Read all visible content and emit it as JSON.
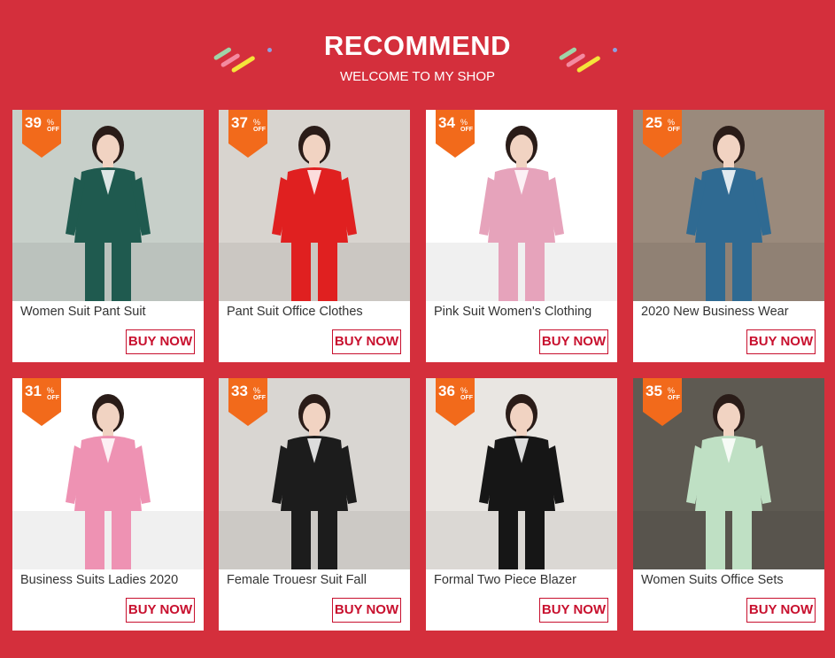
{
  "header": {
    "title": "RECOMMEND",
    "subtitle": "WELCOME TO MY SHOP"
  },
  "colors": {
    "background": "#d42f3c",
    "badge": "#f26a1b",
    "button": "#c8102e"
  },
  "products": [
    {
      "name": "Women Suit Pant Suit",
      "discount": "39",
      "pct": "%",
      "off": "OFF",
      "buy_label": "BUY NOW",
      "suit_color": "#1f5a4f",
      "bg": "#c7cfc9"
    },
    {
      "name": "Pant Suit Office Clothes",
      "discount": "37",
      "pct": "%",
      "off": "OFF",
      "buy_label": "BUY NOW",
      "suit_color": "#e02020",
      "bg": "#d8d4cf"
    },
    {
      "name": "Pink Suit Women's Clothing",
      "discount": "34",
      "pct": "%",
      "off": "OFF",
      "buy_label": "BUY NOW",
      "suit_color": "#e6a3bb",
      "bg": "#ffffff"
    },
    {
      "name": "2020 New Business Wear",
      "discount": "25",
      "pct": "%",
      "off": "OFF",
      "buy_label": "BUY NOW",
      "suit_color": "#2f6a92",
      "bg": "#9a8a7c"
    },
    {
      "name": "Business Suits Ladies 2020",
      "discount": "31",
      "pct": "%",
      "off": "OFF",
      "buy_label": "BUY NOW",
      "suit_color": "#ee92b3",
      "bg": "#ffffff"
    },
    {
      "name": "Female Trouesr Suit Fall",
      "discount": "33",
      "pct": "%",
      "off": "OFF",
      "buy_label": "BUY NOW",
      "suit_color": "#1c1c1c",
      "bg": "#d9d6d2"
    },
    {
      "name": "Formal Two Piece Blazer",
      "discount": "36",
      "pct": "%",
      "off": "OFF",
      "buy_label": "BUY NOW",
      "suit_color": "#161616",
      "bg": "#e9e6e2"
    },
    {
      "name": "Women Suits Office Sets",
      "discount": "35",
      "pct": "%",
      "off": "OFF",
      "buy_label": "BUY NOW",
      "suit_color": "#bfe0c4",
      "bg": "#5e5a52"
    }
  ]
}
